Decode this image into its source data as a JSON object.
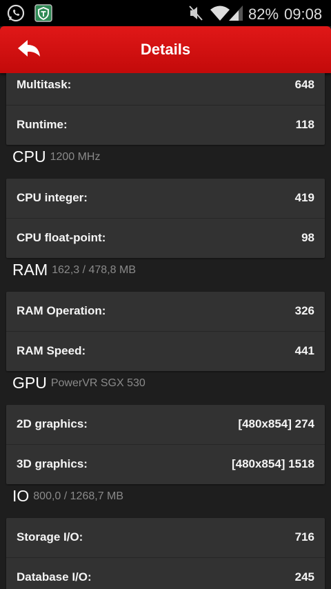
{
  "status_bar": {
    "battery": "82%",
    "time": "09:08"
  },
  "header": {
    "title": "Details"
  },
  "groups": [
    {
      "rows": [
        {
          "label": "Multitask:",
          "value": "648"
        },
        {
          "label": "Runtime:",
          "value": "118"
        }
      ]
    },
    {
      "name": "CPU",
      "sub": "1200 MHz",
      "rows": [
        {
          "label": "CPU integer:",
          "value": "419"
        },
        {
          "label": "CPU float-point:",
          "value": "98"
        }
      ]
    },
    {
      "name": "RAM",
      "sub": "162,3 / 478,8 MB",
      "rows": [
        {
          "label": "RAM Operation:",
          "value": "326"
        },
        {
          "label": "RAM Speed:",
          "value": "441"
        }
      ]
    },
    {
      "name": "GPU",
      "sub": "PowerVR SGX 530",
      "rows": [
        {
          "label": "2D graphics:",
          "value": "[480x854] 274"
        },
        {
          "label": "3D graphics:",
          "value": "[480x854] 1518"
        }
      ]
    },
    {
      "name": "IO",
      "sub": "800,0 / 1268,7 MB",
      "rows": [
        {
          "label": "Storage I/O:",
          "value": "716"
        },
        {
          "label": "Database I/O:",
          "value": "245"
        }
      ]
    }
  ],
  "colors": {
    "action_bar": "#d01010",
    "background": "#1e1e1e",
    "card": "#323232"
  }
}
